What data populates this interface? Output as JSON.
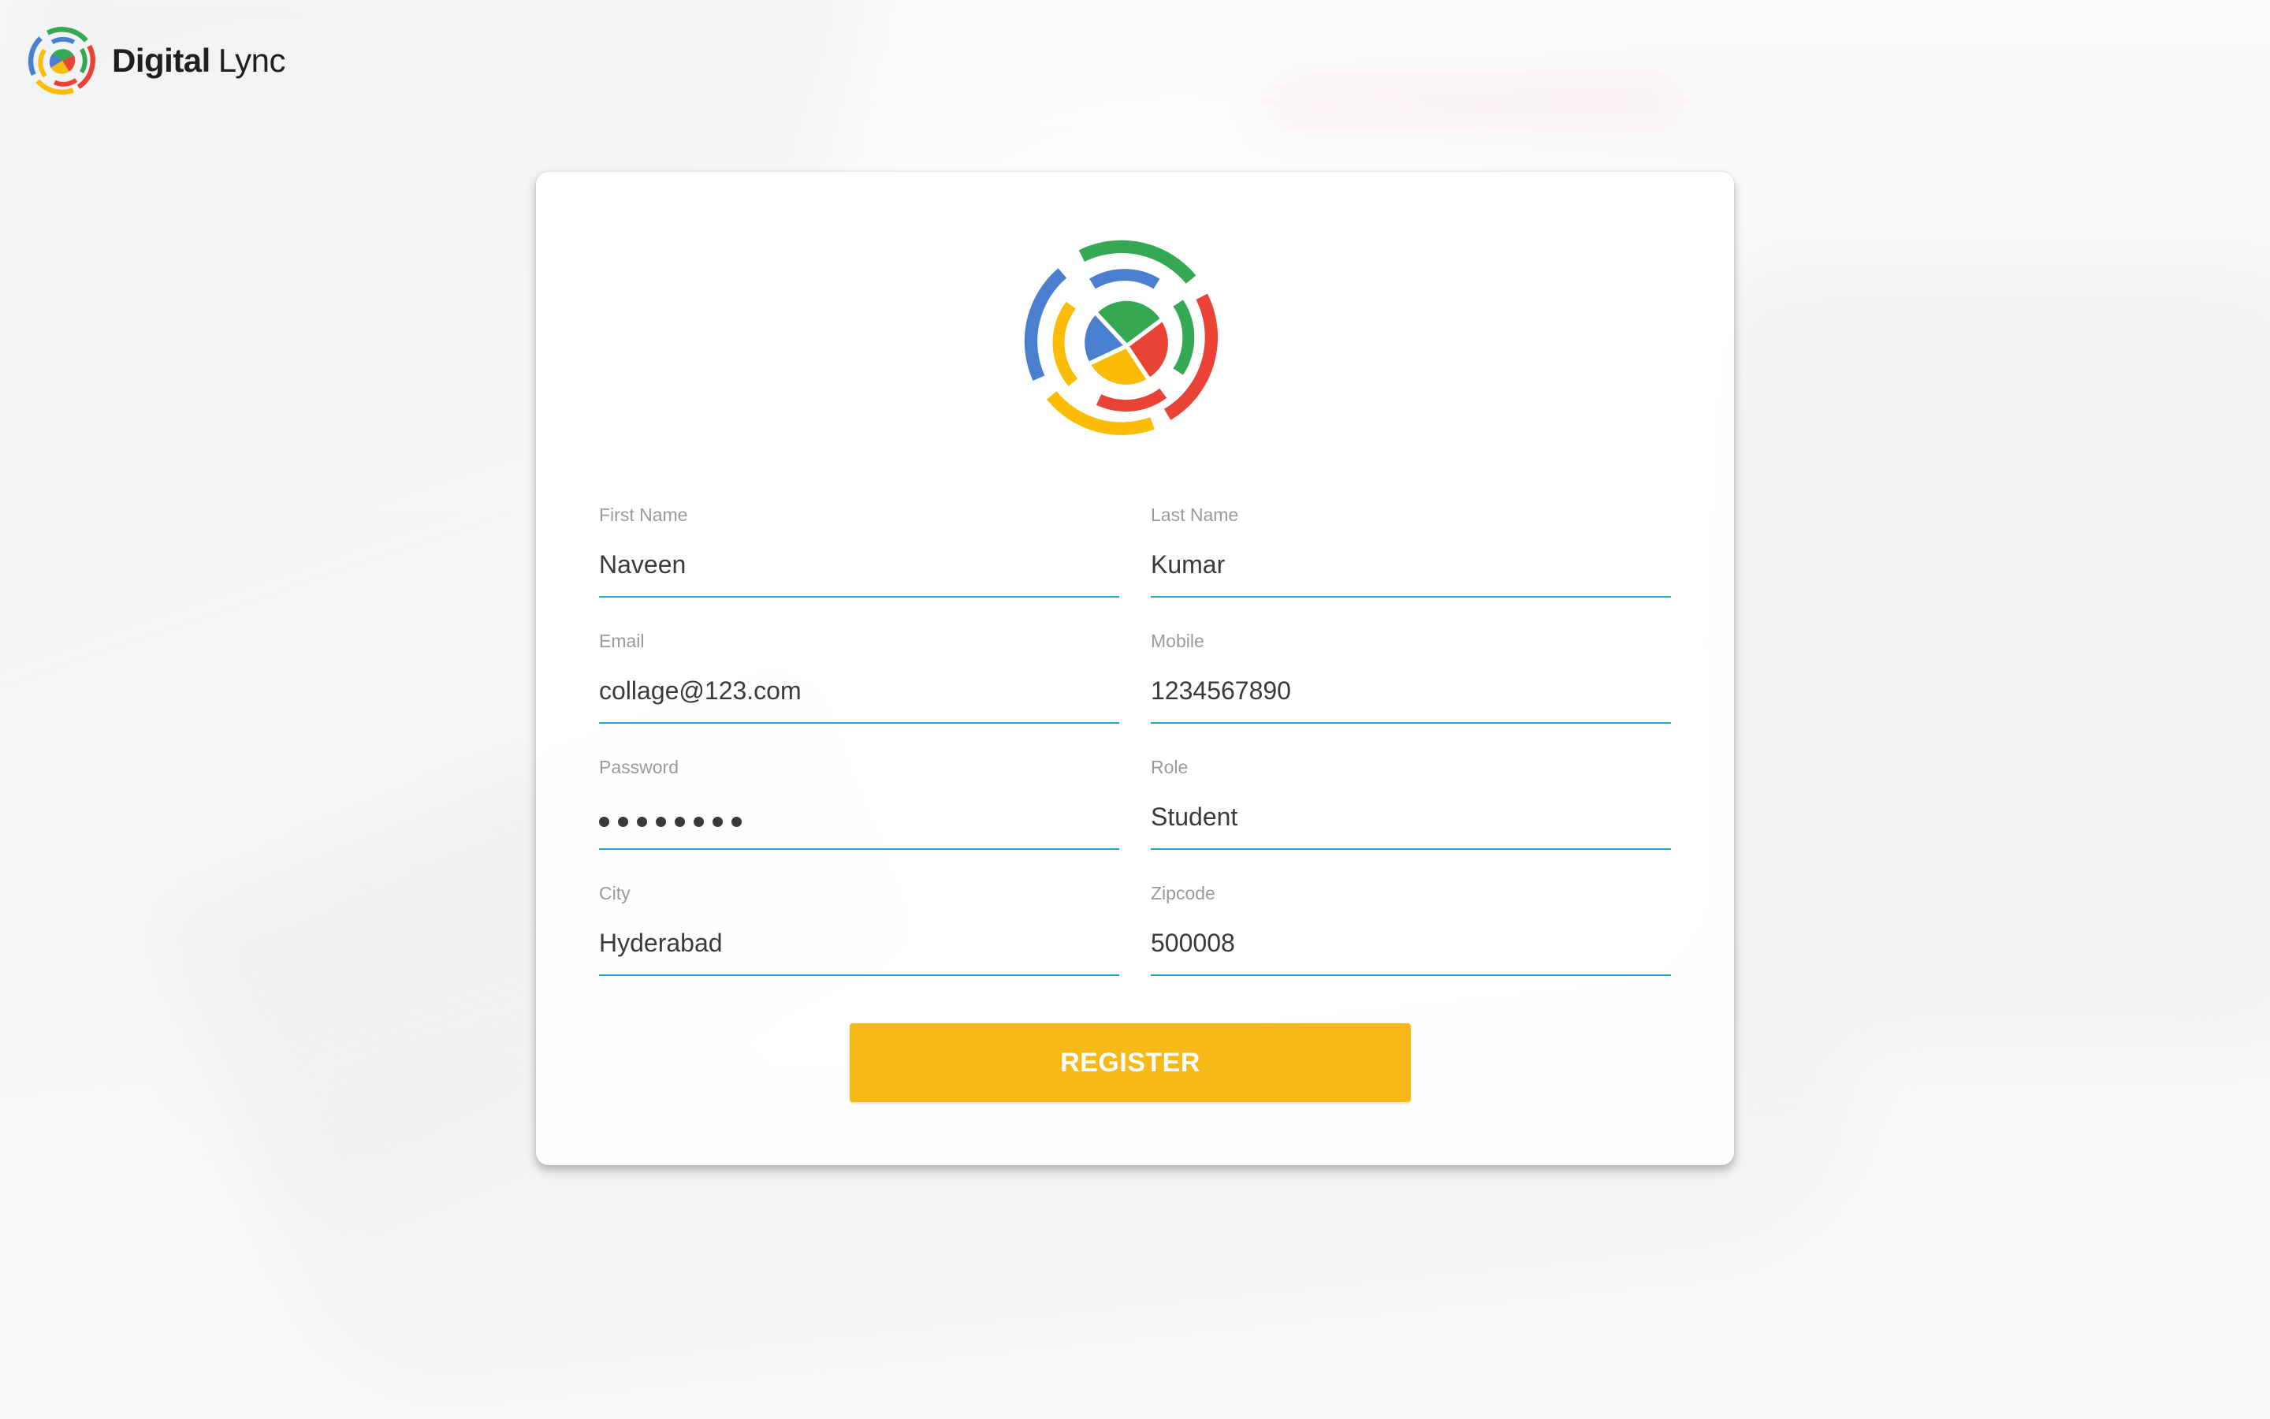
{
  "brand": {
    "name_strong": "Digital",
    "name_light": "Lync",
    "logo_icon": "digital-lync-logo-icon",
    "colors": {
      "green": "#34a853",
      "red": "#ea4335",
      "yellow": "#fbbc05",
      "blue": "#4a7fd0"
    }
  },
  "form": {
    "first_name": {
      "label": "First Name",
      "value": "Naveen"
    },
    "last_name": {
      "label": "Last Name",
      "value": "Kumar"
    },
    "email": {
      "label": "Email",
      "value": "collage@123.com"
    },
    "mobile": {
      "label": "Mobile",
      "value": "1234567890"
    },
    "password": {
      "label": "Password",
      "masked_length": 8
    },
    "role": {
      "label": "Role",
      "value": "Student"
    },
    "city": {
      "label": "City",
      "value": "Hyderabad"
    },
    "zipcode": {
      "label": "Zipcode",
      "value": "500008"
    },
    "underline_color": "#2aa3d8"
  },
  "actions": {
    "register_label": "REGISTER",
    "register_color": "#f7b917"
  }
}
